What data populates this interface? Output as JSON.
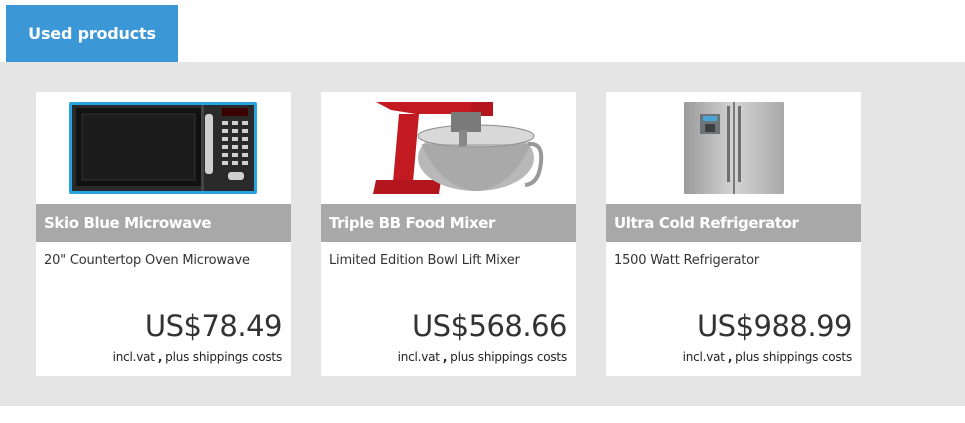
{
  "tab": {
    "label": "Used products"
  },
  "products": [
    {
      "name": "Skio Blue Microwave",
      "description": "20\" Countertop Oven Microwave",
      "price": "US$78.49",
      "vat_note": "incl.vat",
      "shipping_note": "plus shippings costs",
      "image_icon": "microwave-image"
    },
    {
      "name": "Triple BB Food Mixer",
      "description": "Limited Edition Bowl Lift Mixer",
      "price": "US$568.66",
      "vat_note": "incl.vat",
      "shipping_note": "plus shippings costs",
      "image_icon": "stand-mixer-image"
    },
    {
      "name": "Ultra Cold Refrigerator",
      "description": "1500 Watt Refrigerator",
      "price": "US$988.99",
      "vat_note": "incl.vat",
      "shipping_note": "plus shippings costs",
      "image_icon": "refrigerator-image"
    }
  ],
  "colors": {
    "accent": "#3b97d6",
    "panel": "#e5e5e5",
    "name_bar": "#a8a8a8"
  }
}
